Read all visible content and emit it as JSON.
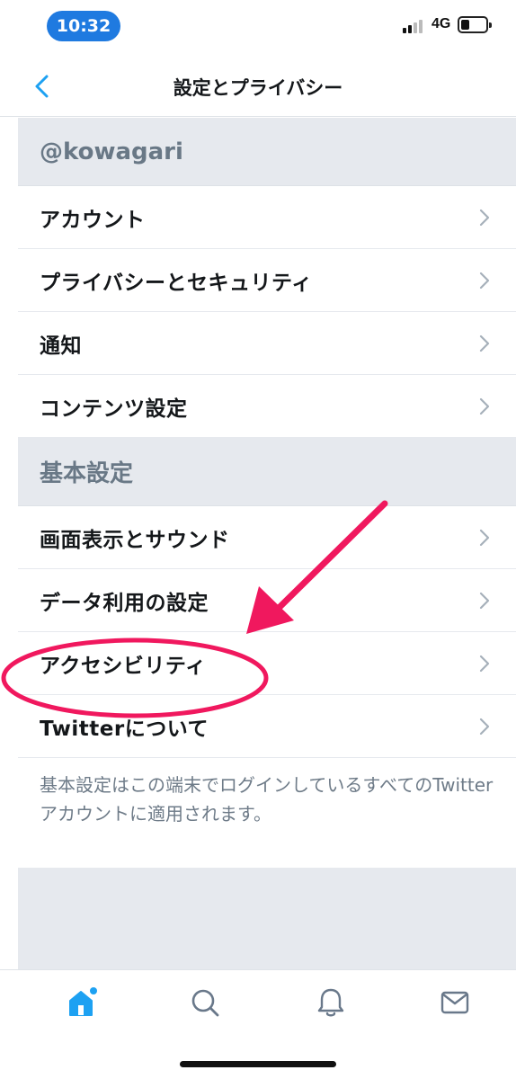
{
  "status_bar": {
    "time": "10:32",
    "network": "4G",
    "time_pill_color": "#1f7ae0"
  },
  "nav": {
    "title": "設定とプライバシー",
    "back_icon": "chevron-left-icon",
    "accent_color": "#1da1f2"
  },
  "sections": [
    {
      "header": "@kowagari",
      "items": [
        {
          "label": "アカウント"
        },
        {
          "label": "プライバシーとセキュリティ"
        },
        {
          "label": "通知"
        },
        {
          "label": "コンテンツ設定"
        }
      ]
    },
    {
      "header": "基本設定",
      "items": [
        {
          "label": "画面表示とサウンド"
        },
        {
          "label": "データ利用の設定"
        },
        {
          "label": "アクセシビリティ",
          "highlighted": true
        },
        {
          "label": "Twitterについて"
        }
      ]
    }
  ],
  "footer_note": "基本設定はこの端末でログインしているすべてのTwitterアカウントに適用されます。",
  "annotation": {
    "type": "arrow-and-circle",
    "target": "アクセシビリティ",
    "color": "#f0185e"
  },
  "tab_bar": {
    "tabs": [
      {
        "name": "home",
        "icon": "home-icon",
        "active": true
      },
      {
        "name": "search",
        "icon": "search-icon",
        "active": false
      },
      {
        "name": "notifications",
        "icon": "bell-icon",
        "active": false
      },
      {
        "name": "messages",
        "icon": "mail-icon",
        "active": false
      }
    ]
  }
}
